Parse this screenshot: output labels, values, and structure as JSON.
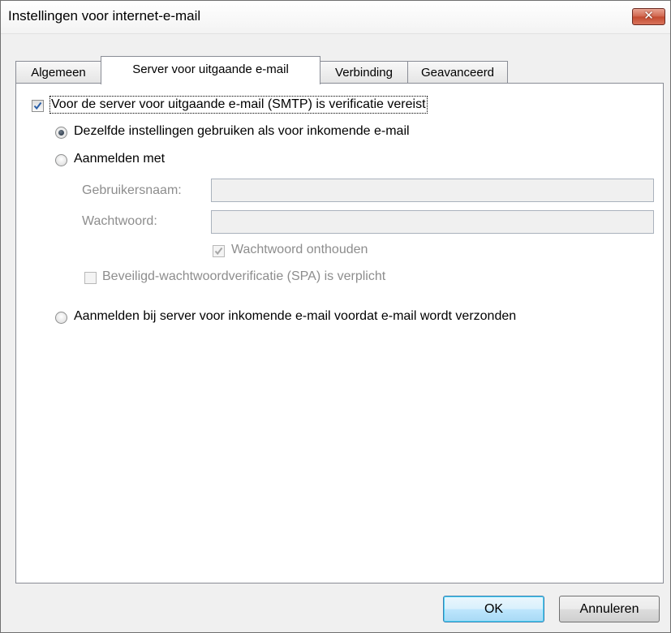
{
  "window": {
    "title": "Instellingen voor internet-e-mail",
    "close_glyph": "✕"
  },
  "tabs": [
    {
      "label": "Algemeen"
    },
    {
      "label": "Server voor uitgaande e-mail"
    },
    {
      "label": "Verbinding"
    },
    {
      "label": "Geavanceerd"
    }
  ],
  "outgoing": {
    "smtp_auth": {
      "label": "Voor de server voor uitgaande e-mail (SMTP) is verificatie vereist",
      "checked": true
    },
    "options": [
      {
        "label": "Dezelfde instellingen gebruiken als voor inkomende e-mail",
        "selected": true
      },
      {
        "label": "Aanmelden met",
        "selected": false
      },
      {
        "label": "Aanmelden bij server voor inkomende e-mail voordat e-mail wordt verzonden",
        "selected": false
      }
    ],
    "username_label": "Gebruikersnaam:",
    "username_value": "",
    "password_label": "Wachtwoord:",
    "password_value": "",
    "remember_password": {
      "label": "Wachtwoord onthouden",
      "checked": true
    },
    "spa": {
      "label": "Beveiligd-wachtwoordverificatie (SPA) is verplicht",
      "checked": false
    }
  },
  "buttons": {
    "ok": "OK",
    "cancel": "Annuleren"
  }
}
